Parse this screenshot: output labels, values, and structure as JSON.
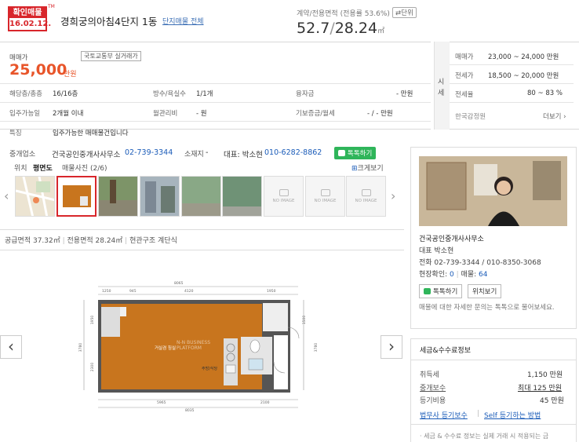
{
  "header": {
    "stamp_top": "확인매물",
    "stamp_date": "16.02.12.",
    "trademark": "TM",
    "title": "경희궁의아침4단지 1동",
    "title_link": "단지매물 전체",
    "area_label": "계약/전용면적 (전용률 53.6%)",
    "unit_button": "단위",
    "area_supply": "52.7",
    "area_sep": "/",
    "area_exclusive": "28.24",
    "area_unit": "㎡"
  },
  "price": {
    "label": "매매가",
    "molit_button": "국토교통부 실거래가",
    "value": "25,000",
    "unit": "만원"
  },
  "details": {
    "floor_label": "해당층/총층",
    "floor_value": "16/16층",
    "rooms_label": "방수/욕실수",
    "rooms_value": "1/1개",
    "loan_label": "융자금",
    "loan_value": "- 만원",
    "movein_label": "입주가능일",
    "movein_value": "2개월 이내",
    "mgmt_label": "월관리비",
    "mgmt_value": "- 원",
    "deposit_label": "기보증금/월세",
    "deposit_value": "- / - 만원",
    "feature_label": "특징",
    "feature_value": "입주가능한 매매물건입니다"
  },
  "market": {
    "side_label_1": "시",
    "side_label_2": "세",
    "sale_label": "매매가",
    "sale_value": "23,000 ~ 24,000 만원",
    "jeonse_label": "전세가",
    "jeonse_value": "18,500 ~ 20,000 만원",
    "ratio_label": "전세율",
    "ratio_value": "80 ~ 83 %",
    "appraisal_label": "한국감정원",
    "more_label": "더보기"
  },
  "broker": {
    "agency_label": "중개업소",
    "agency_value": "건국공인중개사사무소",
    "agency_phone": "02-739-3344",
    "location_label": "소재지",
    "location_value": "-",
    "rep_label": "대표: 박소현",
    "rep_phone": "010-6282-8862",
    "talk_button": "톡톡하기"
  },
  "photo_tabs": {
    "tab_location": "위치",
    "tab_plan": "평면도",
    "tab_photos": "매물사진",
    "photo_count": "(2/6)",
    "enlarge": "크게보기",
    "no_image": "NO IMAGE"
  },
  "area_info": {
    "supply": "공급면적 37.32㎡",
    "exclusive": "전용면적 28.24㎡",
    "structure": "현관구조 계단식"
  },
  "floor_plan": {
    "dims_top": [
      "8065",
      "1250",
      "945",
      "4120",
      "1950"
    ],
    "dims_bottom": [
      "5965",
      "2100",
      "8035"
    ],
    "dims_left": [
      "1950",
      "3780",
      "2300"
    ],
    "dims_right": [
      "1500",
      "3780"
    ],
    "room_label": "거실겸 침실",
    "kitchen_label": "주방/식당",
    "watermark": "N-N BUSINESS PLATFORM"
  },
  "agent": {
    "name": "건국공인중개사사무소",
    "rep": "대표  박소현",
    "phone": "전화  02-739-3344 / 010-8350-3068",
    "inspect_label": "현장확인:",
    "inspect_count": "0",
    "listings_label": "매물:",
    "listings_count": "64",
    "talk_button": "톡톡하기",
    "location_button": "위치보기",
    "note": "매물에 대한 자세한 문의는 톡톡으로 물어보세요."
  },
  "tax": {
    "title": "세금&수수료정보",
    "acq_label": "취득세",
    "acq_value": "1,150 만원",
    "fee_label": "중개보수",
    "fee_value": "최대 125 만원",
    "reg_label": "등기비용",
    "reg_value": "45 만원",
    "link1": "법무사 등기보수",
    "link2": "Self 등기하는 방법",
    "footnote": "· 세금 & 수수료 정보는 실제 거래 시 적용되는 금"
  },
  "colors": {
    "accent": "#e8552a",
    "stamp": "#d8262b",
    "link": "#1a5bb8",
    "talk": "#2fb55a",
    "floor": "#c8751e"
  }
}
